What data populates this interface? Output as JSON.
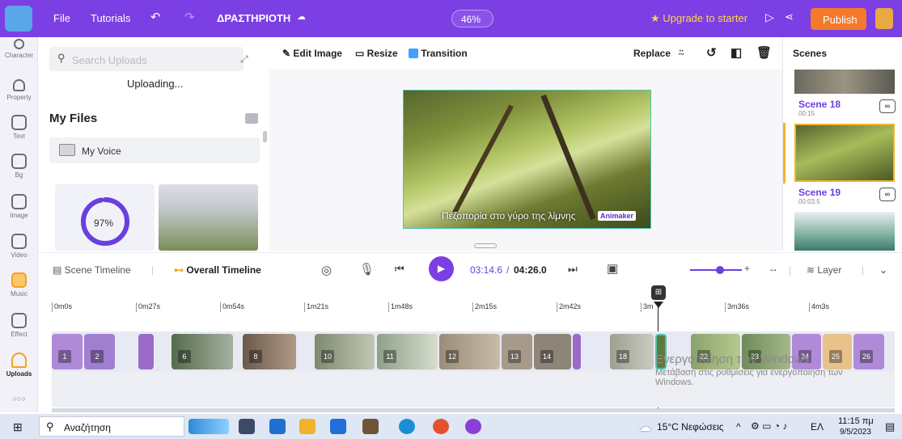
{
  "topbar": {
    "file": "File",
    "tutorials": "Tutorials",
    "project_name": "ΔΡΑΣΤΗΡΙΟΤΗ",
    "zoom": "46%",
    "upgrade": "★ Upgrade to starter",
    "publish": "Publish"
  },
  "leftnav": {
    "items": [
      "Character",
      "Property",
      "Text",
      "Bg",
      "Image",
      "Video",
      "Music",
      "Effect",
      "Uploads"
    ],
    "more": "○○○"
  },
  "uploads": {
    "search_placeholder": "Search Uploads",
    "status": "Uploading...",
    "heading": "My Files",
    "folder": "My Voice",
    "progress_label": "97%",
    "progress": 0.97
  },
  "toolbar": {
    "edit_image": "Edit Image",
    "resize": "Resize",
    "transition": "Transition",
    "replace": "Replace"
  },
  "canvas": {
    "caption": "Πεζοπορία στο γύρο της λίμνης",
    "watermark": "Animaker"
  },
  "scenes": {
    "heading": "Scenes",
    "items": [
      {
        "label": "Scene 18",
        "duration": "00:15"
      },
      {
        "label": "Scene 19",
        "duration": "00:03.5"
      }
    ]
  },
  "timeline": {
    "scene_tab": "Scene Timeline",
    "overall_tab": "Overall Timeline",
    "current": "03:14.6",
    "separator": "/",
    "total": "04:26.0",
    "layer": "Layer",
    "ticks": [
      "0m0s",
      "0m27s",
      "0m54s",
      "1m21s",
      "1m48s",
      "2m15s",
      "2m42s",
      "3m",
      "3m36s",
      "4m3s"
    ],
    "clips": [
      "1",
      "2",
      "6",
      "8",
      "10",
      "11",
      "12",
      "13",
      "14",
      "18",
      "22",
      "23",
      "24",
      "25",
      "26"
    ]
  },
  "watermark": {
    "title": "Ενεργοποίηση των Windows",
    "line1": "Μετάβαση στις ρυθμίσεις για ενεργοποίηση των",
    "line2": "Windows."
  },
  "taskbar": {
    "search": "Αναζήτηση",
    "weather": "15°C Νεφώσεις",
    "lang": "ΕΛ",
    "time": "11:15 πμ",
    "date": "9/5/2023"
  }
}
